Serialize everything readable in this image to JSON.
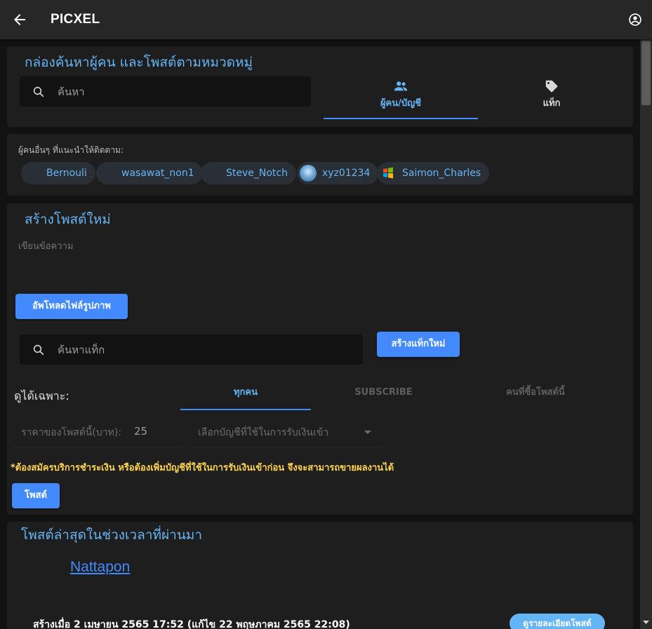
{
  "appbar": {
    "title": "PICXEL",
    "back_icon": "arrow-left-icon",
    "account_icon": "account-circle-icon"
  },
  "search_card": {
    "title": "กล่องค้นหาผู้คน และโพสต์ตามหมวดหมู่",
    "search_placeholder": "ค้นหา",
    "tabs": [
      {
        "label": "ผู้คน/บัญชี",
        "icon": "people-icon",
        "active": true
      },
      {
        "label": "แท็ก",
        "icon": "tag-icon",
        "active": false
      }
    ]
  },
  "suggest_card": {
    "label": "ผู้คนอื่นๆ ที่แนะนำให้ติดตาม:",
    "users": [
      "Bernouli",
      "wasawat_non1",
      "Steve_Notch",
      "xyz01234",
      "Saimon_Charles"
    ]
  },
  "create_card": {
    "title": "สร้างโพสต์ใหม่",
    "message_placeholder": "เขียนข้อความ",
    "upload_button": "อัพโหลดไฟล์รูปภาพ",
    "tag_search_placeholder": "ค้นหาแท็ก",
    "new_tag_button": "สร้างแท็กใหม่",
    "visibility_label": "ดูได้เฉพาะ:",
    "visibility_tabs": [
      {
        "label": "ทุกคน",
        "active": true
      },
      {
        "label": "SUBSCRIBE",
        "active": false
      },
      {
        "label": "คนที่ซื้อโพสต์นี้",
        "active": false
      }
    ],
    "price_label": "ราคาของโพสต์นี้(บาท):",
    "price_value": "25",
    "account_select_placeholder": "เลือกบัญชีที่ใช้ในการรับเงินเข้า",
    "warning": "*ต้องสมัครบริการชำระเงิน หรือต้องเพิ่มบัญชีที่ใช้ในการรับเงินเข้าก่อน จึงจะสามารถขายผลงานได้",
    "post_button": "โพสต์"
  },
  "recent_card": {
    "title": "โพสต์ล่าสุดในช่วงเวลาที่ผ่านมา",
    "author": "Nattapon",
    "created_text": "สร้างเมื่อ 2 เมษายน 2565 17:52 (แก้ไข 22 พฤษภาคม 2565 22:08)",
    "details_button": "ดูรายละเอียดโพสต์"
  },
  "colors": {
    "accent": "#448aff",
    "title_blue": "#64b5f6",
    "warning": "#ffd54f",
    "background": "#121212",
    "card": "#1e1e1e"
  }
}
